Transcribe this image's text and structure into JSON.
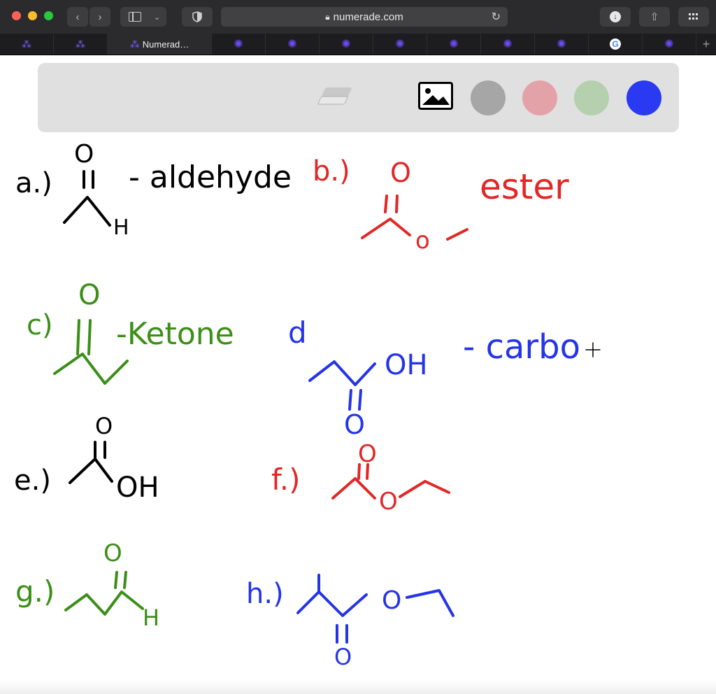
{
  "browser": {
    "url": "numerade.com",
    "active_tab_label": "Numerad…",
    "new_tab_symbol": "+",
    "icons": [
      "close-dot",
      "minimize-dot",
      "zoom-dot",
      "back-icon",
      "forward-icon",
      "sidebar-icon",
      "chevron-down-icon",
      "shield-icon",
      "lock-icon",
      "reload-icon",
      "download-icon",
      "share-icon",
      "grid-icon"
    ]
  },
  "toolbar": {
    "tools": [
      "eraser-icon",
      "image-icon"
    ],
    "colors": [
      "#a6a6a6",
      "#e3a2a8",
      "#b4d0ae",
      "#2a39f2"
    ]
  },
  "whiteboard": {
    "a": {
      "label": "a.)",
      "text": "- aldehyde",
      "atom_o": "O",
      "atom_h": "H"
    },
    "b": {
      "label": "b.)",
      "text": "ester",
      "atom_o1": "O",
      "atom_o2": "o"
    },
    "c": {
      "label": "c)",
      "text": "-Ketone",
      "atom_o": "O"
    },
    "d": {
      "label": "d",
      "text": "- carbo",
      "atom_oh": "OH",
      "atom_o": "O"
    },
    "e": {
      "label": "e.)",
      "atom_o": "O",
      "atom_oh": "OH"
    },
    "f": {
      "label": "f.)",
      "atom_o1": "O",
      "atom_o2": "O"
    },
    "g": {
      "label": "g.)",
      "atom_o": "O",
      "atom_h": "H"
    },
    "h": {
      "label": "h.)",
      "atom_o1": "O",
      "atom_o2": "O"
    },
    "ink": {
      "black": "#000000",
      "red": "#e32626",
      "green": "#3b8f17",
      "blue": "#2434e8"
    }
  }
}
